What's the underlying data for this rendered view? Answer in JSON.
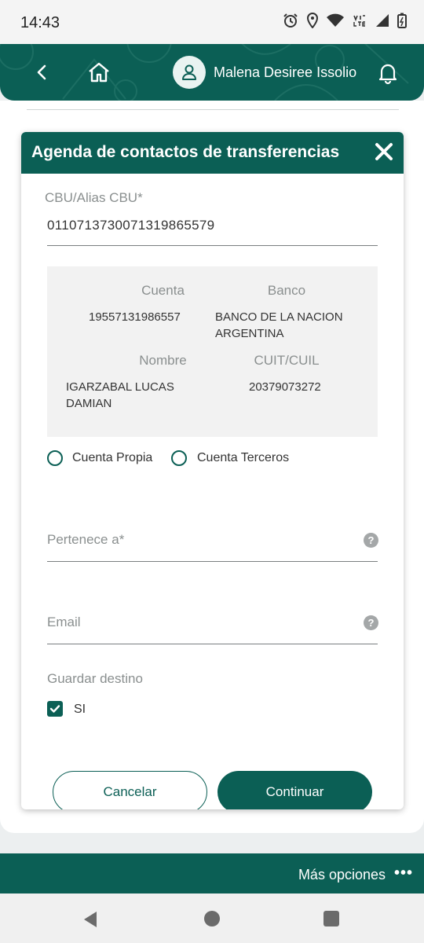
{
  "status_bar": {
    "time": "14:43"
  },
  "header": {
    "user_name": "Malena Desiree Issolio",
    "icons": {
      "back": "chevron-left-icon",
      "home": "home-icon",
      "avatar": "user-icon",
      "notifications": "bell-icon"
    }
  },
  "modal": {
    "title": "Agenda de contactos de transferencias",
    "cbu_label": "CBU/Alias CBU",
    "required_mark": "*",
    "cbu_value": "0110713730071319865579",
    "info": {
      "cuenta_label": "Cuenta",
      "cuenta_value": "19557131986557",
      "banco_label": "Banco",
      "banco_line1": "BANCO DE LA NACION",
      "banco_line2": "ARGENTINA",
      "nombre_label": "Nombre",
      "nombre_line1": "IGARZABAL LUCAS",
      "nombre_line2": "DAMIAN",
      "cuit_label": "CUIT/CUIL",
      "cuit_value": "20379073272"
    },
    "radio_options": [
      "Cuenta Propia",
      "Cuenta Terceros"
    ],
    "pertenece_label": "Pertenece a",
    "email_label": "Email",
    "guardar_label": "Guardar destino",
    "guardar_option": "SI",
    "help_glyph": "?",
    "cancel_label": "Cancelar",
    "continue_label": "Continuar"
  },
  "footer": {
    "more_label": "Más opciones",
    "more_dots": "•••"
  },
  "colors": {
    "brand": "#0b5f55",
    "muted_text": "#8a8f8f",
    "info_bg": "#f2f2f2"
  }
}
